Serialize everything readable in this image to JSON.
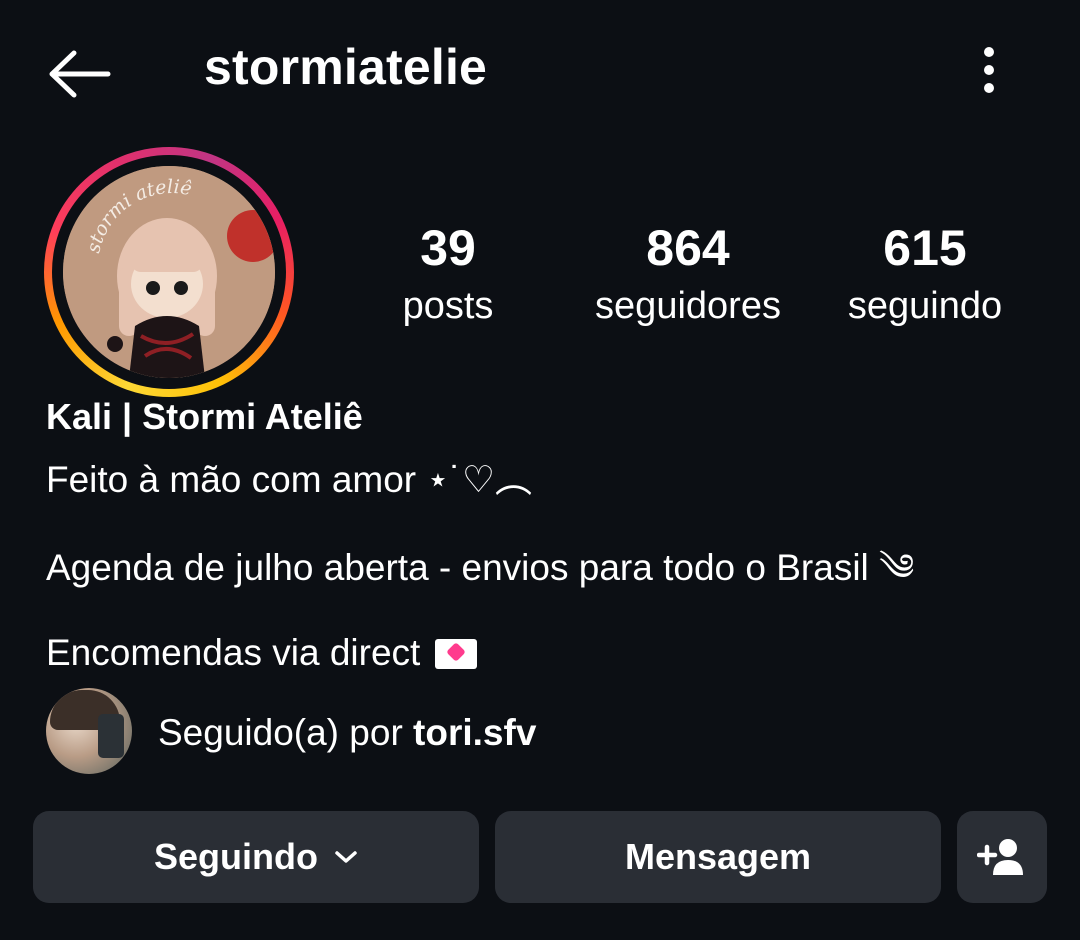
{
  "header": {
    "username": "stormiatelie",
    "back_icon": "arrow-left-icon",
    "more_icon": "more-vertical-icon"
  },
  "profile": {
    "avatar_text": "stormi ateliê",
    "stats": {
      "posts": {
        "value": "39",
        "label": "posts"
      },
      "followers": {
        "value": "864",
        "label": "seguidores"
      },
      "following": {
        "value": "615",
        "label": "seguindo"
      }
    }
  },
  "bio": {
    "display_name": "Kali | Stormi Ateliê",
    "line1": "Feito à mão com amor ⋆˙♡︵",
    "line2": "Agenda de julho aberta - envios para todo o Brasil ༄",
    "line3": "Encomendas via direct"
  },
  "followed_by": {
    "prefix": "Seguido(a) por ",
    "user": "tori.sfv"
  },
  "actions": {
    "following_label": "Seguindo",
    "message_label": "Mensagem",
    "add_icon": "add-person-icon"
  },
  "colors": {
    "background": "#0c0f14",
    "button_bg": "#2a2e35",
    "text": "#ffffff"
  }
}
